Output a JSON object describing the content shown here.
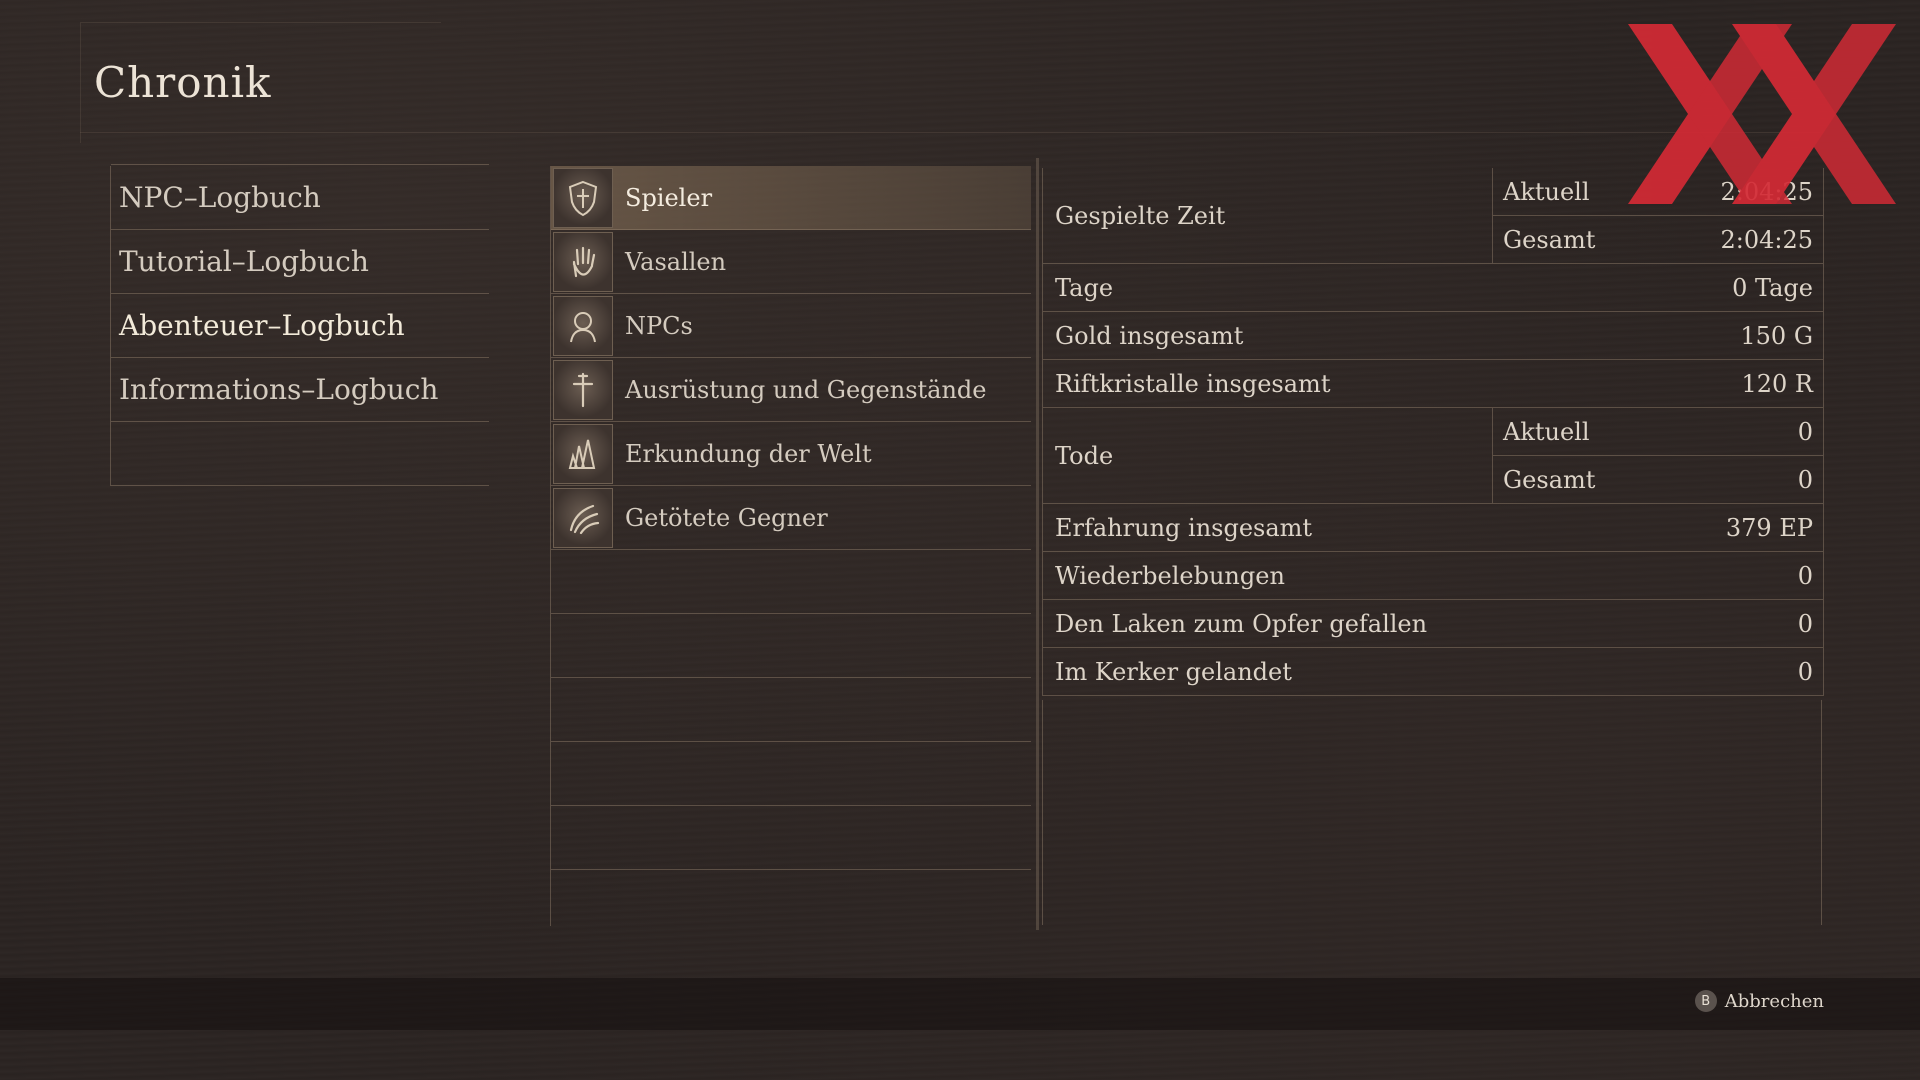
{
  "header": {
    "title": "Chronik"
  },
  "left_menu": {
    "items": [
      {
        "label": "NPC–Logbuch"
      },
      {
        "label": "Tutorial–Logbuch"
      },
      {
        "label": "Abenteuer–Logbuch"
      },
      {
        "label": "Informations–Logbuch"
      }
    ],
    "active_index": 2
  },
  "categories": {
    "items": [
      {
        "label": "Spieler",
        "icon": "shield-emblem-icon"
      },
      {
        "label": "Vasallen",
        "icon": "open-hand-icon"
      },
      {
        "label": "NPCs",
        "icon": "portrait-icon"
      },
      {
        "label": "Ausrüstung und Gegenstände",
        "icon": "sword-cross-icon"
      },
      {
        "label": "Erkundung der Welt",
        "icon": "crystal-cluster-icon"
      },
      {
        "label": "Getötete Gegner",
        "icon": "beast-claw-icon"
      }
    ],
    "selected_index": 0
  },
  "stats": {
    "played_time": {
      "label": "Gespielte Zeit",
      "current_label": "Aktuell",
      "current_value": "2:04:25",
      "total_label": "Gesamt",
      "total_value": "2:04:25"
    },
    "days": {
      "label": "Tage",
      "value": "0 Tage"
    },
    "gold": {
      "label": "Gold insgesamt",
      "value": "150 G"
    },
    "rift": {
      "label": "Riftkristalle insgesamt",
      "value": "120 R"
    },
    "deaths": {
      "label": "Tode",
      "current_label": "Aktuell",
      "current_value": "0",
      "total_label": "Gesamt",
      "total_value": "0"
    },
    "xp": {
      "label": "Erfahrung insgesamt",
      "value": "379 EP"
    },
    "revives": {
      "label": "Wiederbelebungen",
      "value": "0"
    },
    "sheets": {
      "label": "Den Laken zum Opfer gefallen",
      "value": "0"
    },
    "dungeon": {
      "label": "Im Kerker gelandet",
      "value": "0"
    }
  },
  "footer": {
    "button_glyph": "B",
    "cancel_label": "Abbrechen"
  },
  "colors": {
    "watermark_red": "#d42a35",
    "selected_row": "#6e5c4c"
  }
}
